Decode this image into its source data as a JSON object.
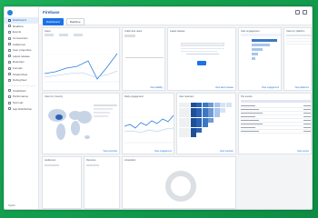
{
  "app": {
    "brand": "Firebase"
  },
  "topbar": {
    "tabs": [
      "Dashboard",
      "Realtime"
    ]
  },
  "sidebar": {
    "items": [
      {
        "label": "Dashboard",
        "active": true
      },
      {
        "label": "Realtime"
      },
      {
        "label": "Events"
      },
      {
        "label": "Conversions"
      },
      {
        "label": "Audiences"
      },
      {
        "label": "User properties"
      },
      {
        "label": "Latest release"
      },
      {
        "label": "Retention"
      },
      {
        "label": "Funnels"
      },
      {
        "label": "StreamView"
      },
      {
        "label": "DebugView"
      }
    ],
    "items2": [
      {
        "label": "Crashlytics"
      },
      {
        "label": "Performance"
      },
      {
        "label": "Test Lab"
      },
      {
        "label": "App Distribution"
      }
    ],
    "footer": "Spark"
  },
  "cards": {
    "users": {
      "title": "Users",
      "link": ""
    },
    "stability": {
      "title": "Crash-free users",
      "link": "View stability"
    },
    "latest": {
      "title": "Latest release",
      "link": "View latest release"
    },
    "engagement": {
      "title": "User engagement",
      "link": "View engagement"
    },
    "platforms": {
      "title": "Users by platform",
      "link": "View platforms"
    },
    "country": {
      "title": "Users by Country",
      "link": "View countries"
    },
    "daily": {
      "title": "Daily engagement",
      "link": "View engagement"
    },
    "retention": {
      "title": "User retention",
      "link": "View retention"
    },
    "events": {
      "title": "Top events",
      "link": "View events"
    },
    "bottom1": {
      "title": "Audiences"
    },
    "bottom2": {
      "title": "Revenue"
    },
    "bottom3": {
      "title": "Acquisition"
    }
  }
}
